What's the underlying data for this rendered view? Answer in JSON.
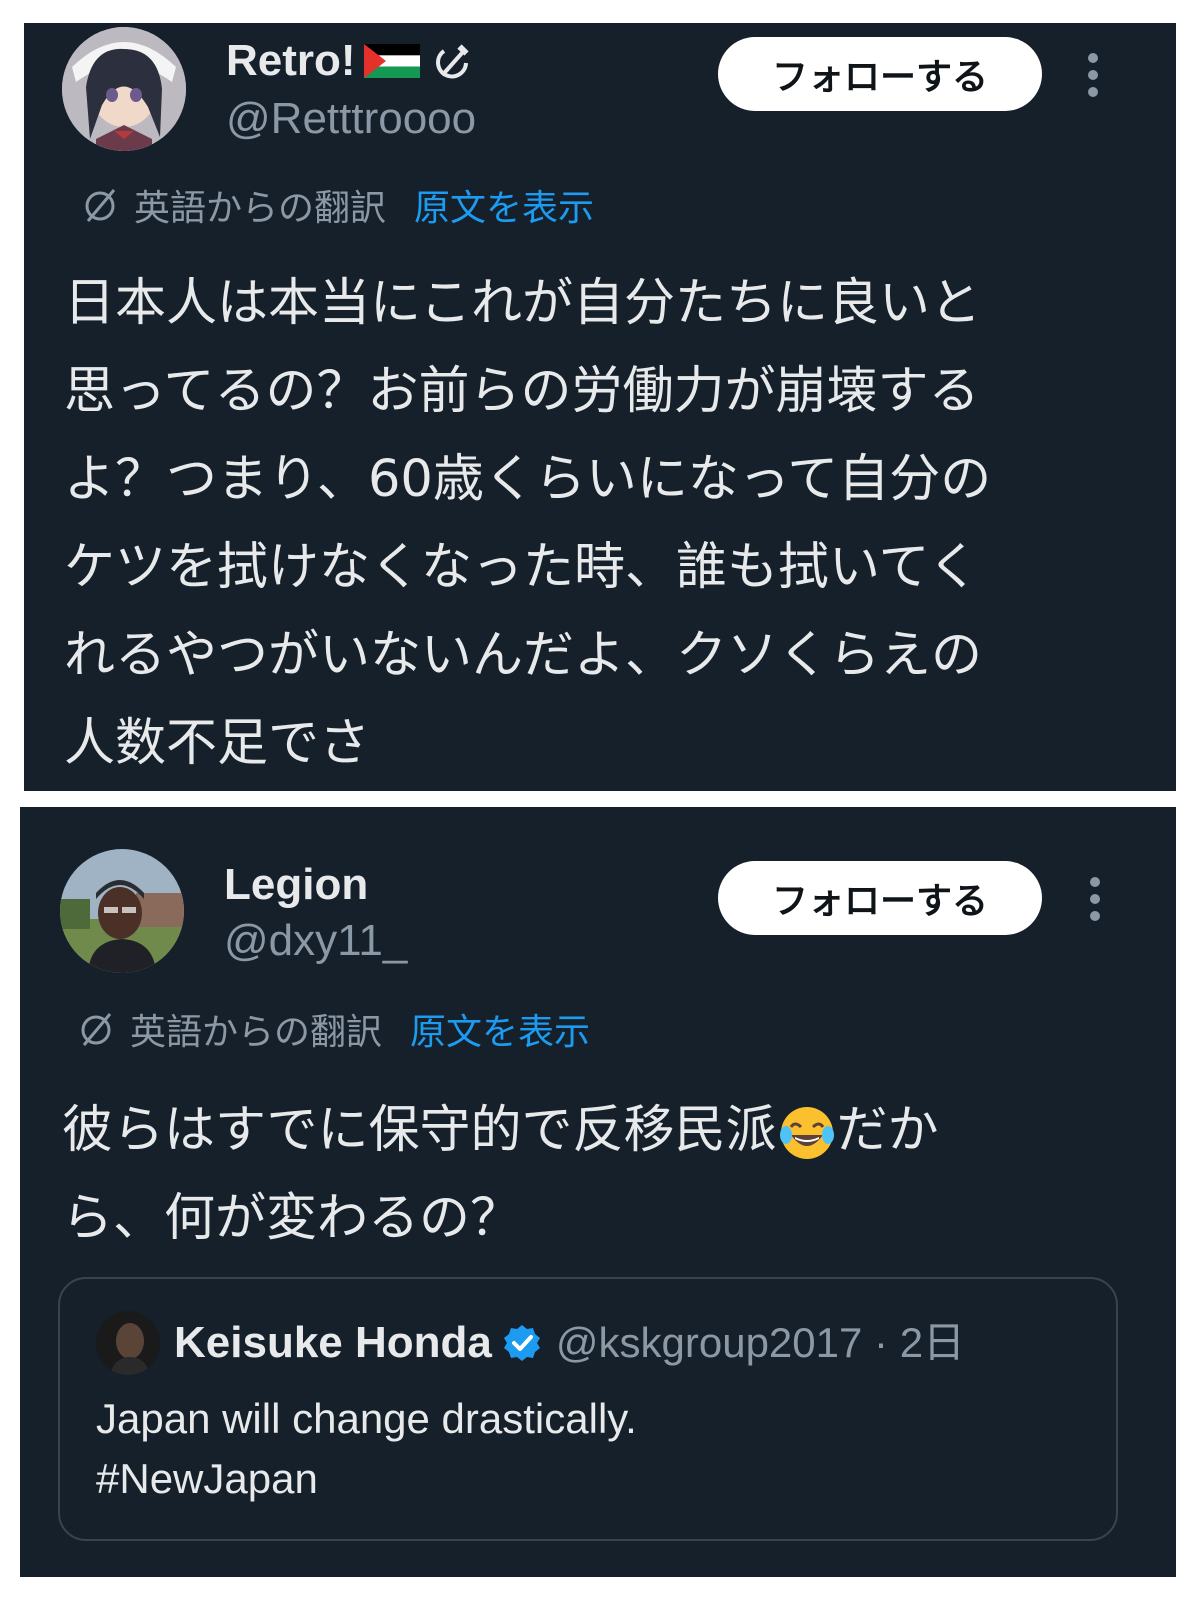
{
  "tweets": [
    {
      "display_name": "Retro!",
      "name_icons": [
        "palestine-flag-icon",
        "hammer-sickle-icon"
      ],
      "handle": "@Retttroooo",
      "follow_label": "フォローする",
      "translation_label": "英語からの翻訳",
      "show_original_label": "原文を表示",
      "body_lines": [
        "日本人は本当にこれが自分たちに良いと",
        "思ってるの？お前らの労働力が崩壊する",
        "よ？つまり、60歳くらいになって自分の",
        "ケツを拭けなくなった時、誰も拭いてく",
        "れるやつがいないんだよ、クソくらえの",
        "人数不足でさ"
      ]
    },
    {
      "display_name": "Legion",
      "handle": "@dxy11_",
      "follow_label": "フォローする",
      "translation_label": "英語からの翻訳",
      "show_original_label": "原文を表示",
      "body_line1_before": "彼らはすでに保守的で反移民派",
      "body_emoji": "laughing-crying-emoji",
      "body_line1_after": "だか",
      "body_line2": "ら、何が変わるの？",
      "quote": {
        "display_name": "Keisuke Honda",
        "verified_icon": "verified-badge-icon",
        "handle_time": "@kskgroup2017 · 2日",
        "text_line1": "Japan will change drastically.",
        "text_line2": "#NewJapan"
      }
    }
  ],
  "colors": {
    "background": "#15202b",
    "text": "#e7e9ea",
    "secondary": "#8b98a5",
    "link": "#1d9bf0",
    "verified": "#1d9bf0",
    "follow_bg": "#ffffff"
  }
}
